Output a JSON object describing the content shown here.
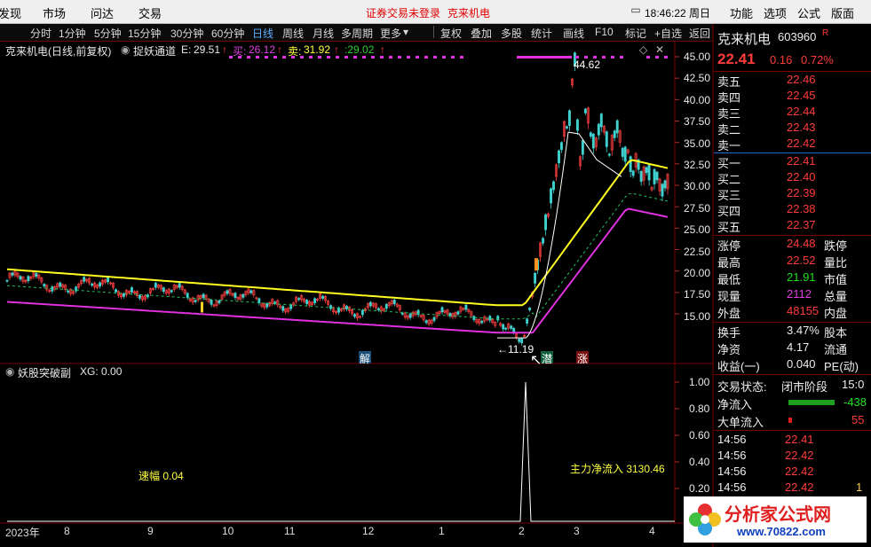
{
  "menubar": {
    "items": [
      "发现",
      "市场",
      "问达",
      "交易"
    ],
    "warning": "证券交易未登录",
    "stock_name": "克来机电",
    "clock": "18:46:22 周日",
    "right_items": [
      "功能",
      "选项",
      "公式",
      "版面"
    ]
  },
  "toolbar": {
    "periods": [
      "分时",
      "1分钟",
      "5分钟",
      "15分钟",
      "30分钟",
      "60分钟",
      "日线",
      "周线",
      "月线",
      "多周期",
      "更多"
    ],
    "active": "日线",
    "tools": [
      "复权",
      "叠加",
      "多股",
      "统计",
      "画线",
      "F10",
      "标记",
      "+自选",
      "返回"
    ]
  },
  "main_chart": {
    "title": "克来机电(日线,前复权)",
    "indicator": "捉妖通道",
    "e_label": "E:",
    "e_value": "29.51",
    "buy_label": "买:",
    "buy_value": "26.12",
    "sell_label": "卖:",
    "sell_value": "31.92",
    "extra_value": ":29.02",
    "y_ticks": [
      "45.00",
      "42.50",
      "40.00",
      "37.50",
      "35.00",
      "32.50",
      "30.00",
      "27.50",
      "25.00",
      "22.50",
      "20.00",
      "17.50",
      "15.00"
    ],
    "high_label": "44.62",
    "low_label": "11.19",
    "badges": [
      "解",
      "潜",
      "涨"
    ]
  },
  "sub_chart": {
    "title": "妖股突破副",
    "xg_label": "XG: 0.00",
    "speed_label": "速幅 0.04",
    "flow_label": "主力净流入 3130.46",
    "y_ticks": [
      "1.00",
      "0.80",
      "0.60",
      "0.40",
      "0.20"
    ]
  },
  "x_axis": [
    "2023年",
    "8",
    "9",
    "10",
    "11",
    "12",
    "1",
    "2",
    "3",
    "4"
  ],
  "quote": {
    "name": "克来机电",
    "code": "603960",
    "flag": "R",
    "price": "22.41",
    "change": "0.16",
    "pct": "0.72%",
    "sell": [
      {
        "label": "卖五",
        "price": "22.46"
      },
      {
        "label": "卖四",
        "price": "22.45"
      },
      {
        "label": "卖三",
        "price": "22.44"
      },
      {
        "label": "卖二",
        "price": "22.43"
      },
      {
        "label": "卖一",
        "price": "22.42"
      }
    ],
    "buy": [
      {
        "label": "买一",
        "price": "22.41"
      },
      {
        "label": "买二",
        "price": "22.40"
      },
      {
        "label": "买三",
        "price": "22.39"
      },
      {
        "label": "买四",
        "price": "22.38"
      },
      {
        "label": "买五",
        "price": "22.37"
      }
    ],
    "stats": [
      {
        "label": "涨停",
        "value": "24.48",
        "right": "跌停"
      },
      {
        "label": "最高",
        "value": "22.52",
        "right": "量比"
      },
      {
        "label": "最低",
        "value": "21.91",
        "right": "市值"
      },
      {
        "label": "现量",
        "value": "2112",
        "right": "总量"
      },
      {
        "label": "外盘",
        "value": "48155",
        "right": "内盘"
      }
    ],
    "stats2": [
      {
        "label": "换手",
        "value": "3.47%",
        "right": "股本"
      },
      {
        "label": "净资",
        "value": "4.17",
        "right": "流通"
      },
      {
        "label": "收益(一)",
        "value": "0.040",
        "right": "PE(动)"
      }
    ],
    "trade_state_label": "交易状态:",
    "trade_state": "闭市阶段",
    "trade_time": "15:0",
    "net_inflow_label": "净流入",
    "net_inflow": "-438",
    "big_inflow_label": "大单流入",
    "big_inflow": "55",
    "ticks": [
      {
        "time": "14:56",
        "price": "22.41",
        "vol": ""
      },
      {
        "time": "14:56",
        "price": "22.42",
        "vol": ""
      },
      {
        "time": "14:56",
        "price": "22.42",
        "vol": ""
      },
      {
        "time": "14:56",
        "price": "22.42",
        "vol": "1"
      }
    ]
  },
  "watermark": {
    "title": "分析家公式网",
    "url": "www.70822.com"
  }
}
